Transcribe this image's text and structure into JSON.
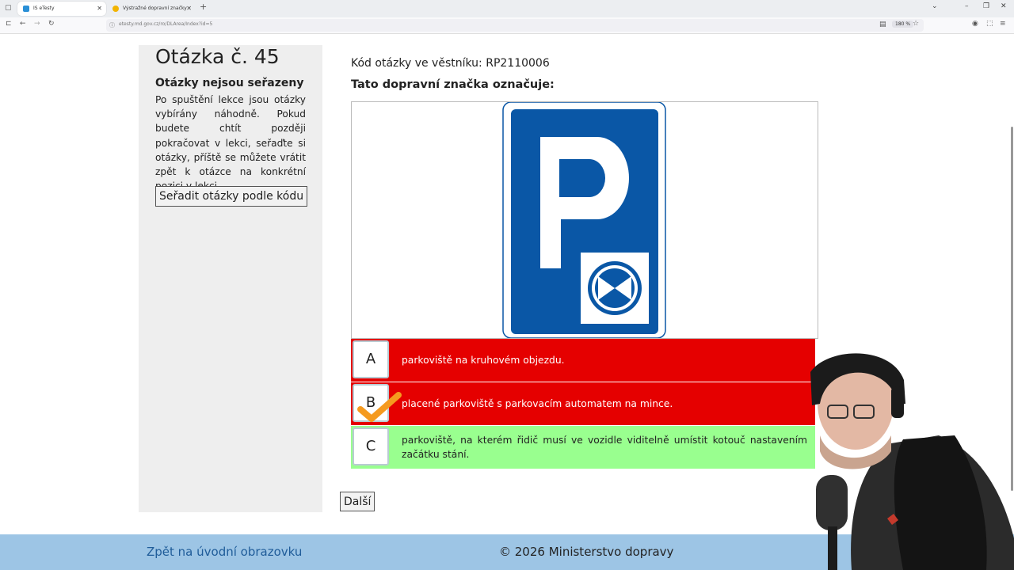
{
  "browser": {
    "tabs": [
      {
        "title": "IS eTesty",
        "active": true
      },
      {
        "title": "Výstražné dopravní značky",
        "active": false
      }
    ],
    "url": "etesty.md.gov.cz/ro/DLArea/Index?id=5",
    "zoom": "180 %"
  },
  "sidebar": {
    "question_number": "Otázka č. 45",
    "heading": "Otázky nejsou seřazeny",
    "text": "Po spuštění lekce jsou otázky vybírány náhodně. Pokud budete chtít později pokračovat v lekci, seřaďte si otázky, příště se můžete vrátit zpět k otázce na konkrétní pozici v lekci.",
    "sort_button": "Seřadit otázky podle kódu"
  },
  "question": {
    "code": "Kód otázky ve věstníku: RP2110006",
    "prompt": "Tato dopravní značka označuje:",
    "sign_letter": "P"
  },
  "answers": [
    {
      "letter": "A",
      "text": "parkoviště na kruhovém objezdu.",
      "state": "wrong",
      "color": "#e50000"
    },
    {
      "letter": "B",
      "text": "placené parkoviště s parkovacím automatem na mince.",
      "state": "wrong-selected",
      "color": "#e50000"
    },
    {
      "letter": "C",
      "text": "parkoviště, na kterém řidič musí ve vozidle viditelně umístit kotouč nastavením začátku stání.",
      "state": "correct",
      "color": "#99ff8f"
    }
  ],
  "next_button": "Další",
  "footer": {
    "back_link": "Zpět na úvodní obrazovku",
    "copyright": "© 2026 Ministerstvo dopravy"
  },
  "colors": {
    "sign_blue": "#0a57a6",
    "footer_bg": "#9dc5e5",
    "check_orange": "#f59a1f"
  }
}
